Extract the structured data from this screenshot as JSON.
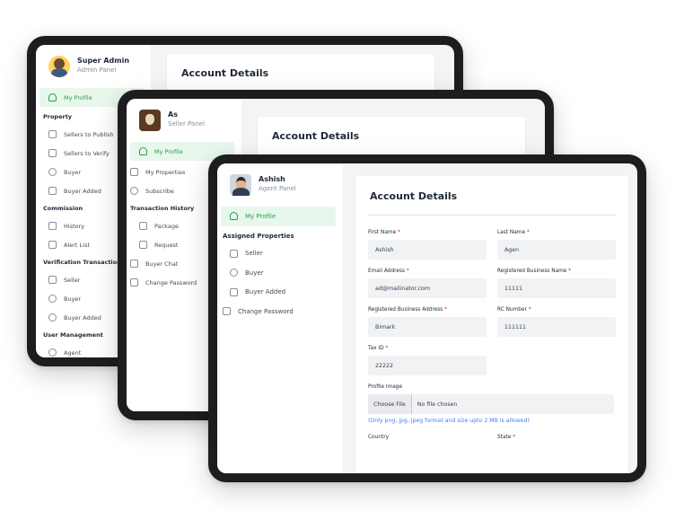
{
  "admin": {
    "name": "Super Admin",
    "role": "Admin Panel",
    "active_item": "My Profile",
    "sections": [
      {
        "heading": "Property",
        "items": [
          "Sellers to Publish",
          "Sellers to Verify",
          "Buyer",
          "Buyer Added"
        ]
      },
      {
        "heading": "Commission",
        "items": [
          "History",
          "Alert List"
        ]
      },
      {
        "heading": "Verification Transaction",
        "items": [
          "Seller",
          "Buyer",
          "Buyer Added"
        ]
      },
      {
        "heading": "User Management",
        "items": [
          "Agent"
        ]
      }
    ],
    "card_title": "Account Details"
  },
  "seller": {
    "name": "As",
    "role": "Seller Panel",
    "active_item": "My Profile",
    "items_top": [
      "My Properties",
      "Subscribe"
    ],
    "section_heading": "Transaction History",
    "section_items": [
      "Package",
      "Request"
    ],
    "items_bottom": [
      "Buyer Chat",
      "Change Password"
    ],
    "card_title": "Account Details"
  },
  "agent": {
    "name": "Ashish",
    "role": "Agent Panel",
    "active_item": "My Profile",
    "section_heading": "Assigned Properties",
    "section_items": [
      "Seller",
      "Buyer",
      "Buyer Added"
    ],
    "items_bottom": [
      "Change Password"
    ],
    "card_title": "Account Details",
    "form": {
      "first_name_label": "First Name",
      "first_name_value": "Ashish",
      "last_name_label": "Last Name",
      "last_name_value": "Agen",
      "email_label": "Email Address",
      "email_value": "ad@mailinator.com",
      "business_name_label": "Registered Business Name",
      "business_name_value": "11111",
      "business_address_label": "Registered Business Address",
      "business_address_value": "Bimark",
      "rc_label": "RC Number",
      "rc_value": "111111",
      "tax_label": "Tax ID",
      "tax_value": "22222",
      "profile_image_label": "Profile Image",
      "choose_file_label": "Choose File",
      "no_file_text": "No file chosen",
      "file_hint": "(Only png, jpg, jpeg format and size upto 2 MB is allowed)",
      "country_label": "Country",
      "state_label": "State",
      "required_mark": "*"
    }
  },
  "colors": {
    "accent_green": "#22a04b",
    "active_bg": "#e8f7ec",
    "hint_blue": "#3b82f6",
    "required_red": "#e11d48",
    "bezel": "#1d1d1f"
  }
}
